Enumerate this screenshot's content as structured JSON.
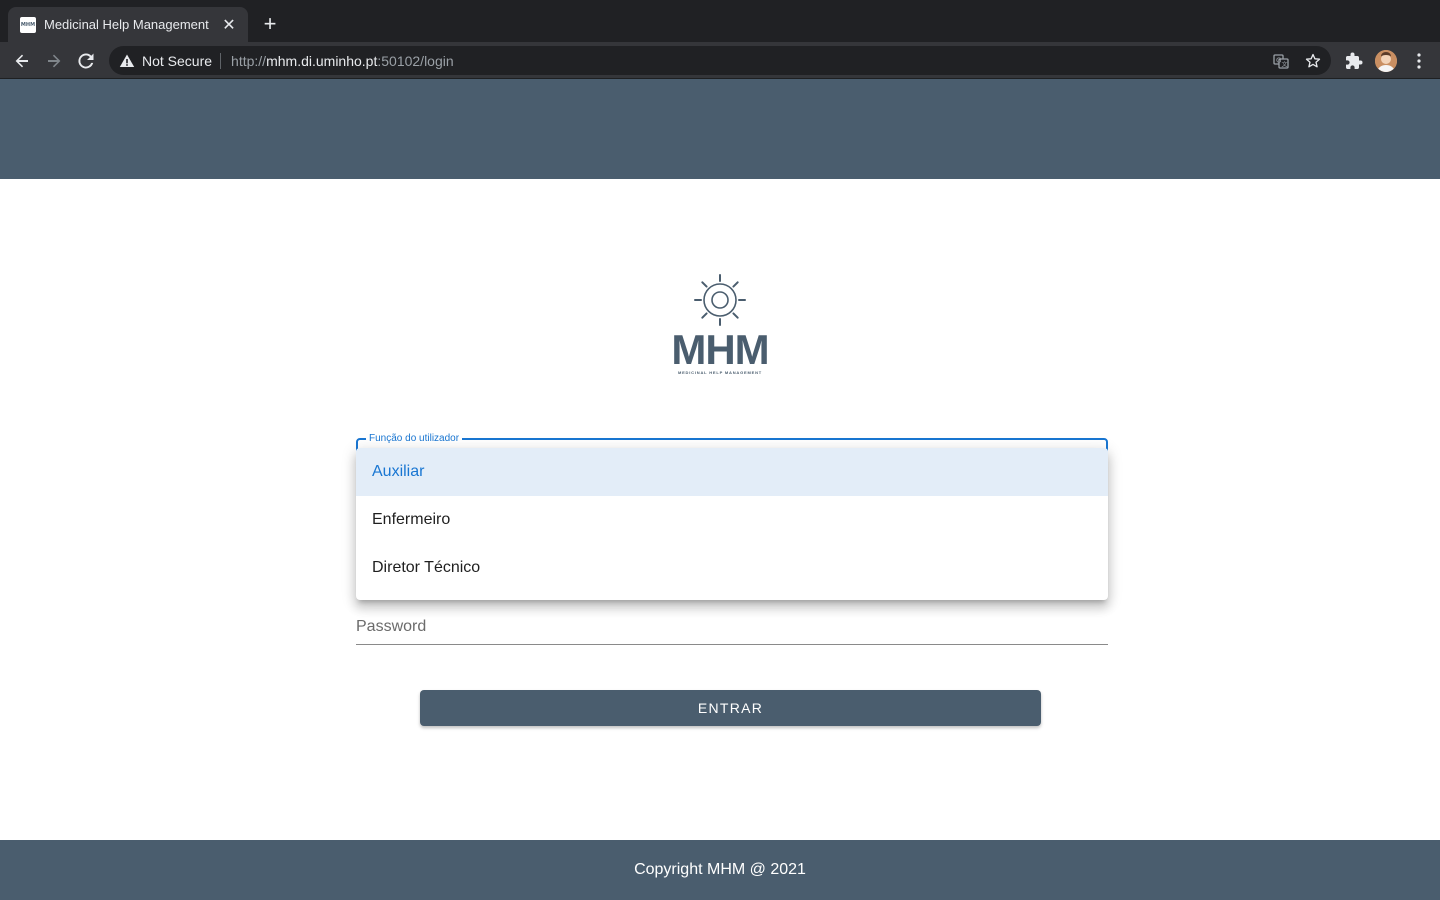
{
  "browser": {
    "tab_title": "Medicinal Help Management",
    "favicon_text": "MHM",
    "security_label": "Not Secure",
    "url_scheme": "http://",
    "url_host": "mhm.di.uminho.pt",
    "url_rest": ":50102/login",
    "icons": [
      "back-icon",
      "forward-icon",
      "reload-icon",
      "warning-icon",
      "translate-icon",
      "star-icon",
      "puzzle-icon",
      "avatar",
      "more-vert-icon"
    ]
  },
  "logo": {
    "text": "MHM",
    "subtitle": "MEDICINAL HELP MANAGEMENT"
  },
  "form": {
    "role_label": "Função do utilizador",
    "role_options": [
      "Auxiliar",
      "Enfermeiro",
      "Diretor Técnico"
    ],
    "role_highlighted": "Auxiliar",
    "password_label": "Password",
    "submit_label": "ENTRAR"
  },
  "footer": {
    "copyright": "Copyright MHM @ 2021"
  },
  "colors": {
    "brand": "#4a5d6e",
    "accent": "#1976d2",
    "highlight": "#e3edf8"
  }
}
